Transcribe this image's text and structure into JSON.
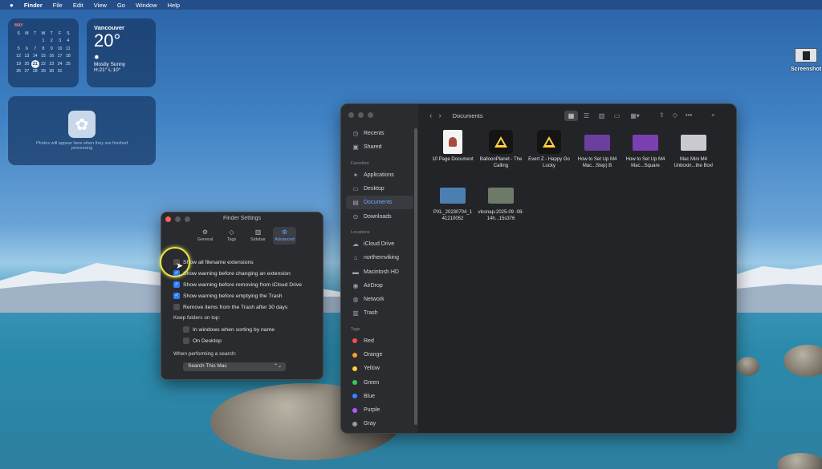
{
  "menubar": {
    "apple": "",
    "app": "Finder",
    "items": [
      "File",
      "Edit",
      "View",
      "Go",
      "Window",
      "Help"
    ]
  },
  "calendar": {
    "month": "MAY",
    "days": [
      "S",
      "M",
      "T",
      "W",
      "T",
      "F",
      "S"
    ],
    "weeks": [
      [
        "",
        "",
        "",
        "1",
        "2",
        "3",
        "4"
      ],
      [
        "5",
        "6",
        "7",
        "8",
        "9",
        "10",
        "11"
      ],
      [
        "12",
        "13",
        "14",
        "15",
        "16",
        "17",
        "18"
      ],
      [
        "19",
        "20",
        "21",
        "22",
        "23",
        "24",
        "25"
      ],
      [
        "26",
        "27",
        "28",
        "29",
        "30",
        "31",
        ""
      ]
    ],
    "today": "21"
  },
  "weather": {
    "city": "Vancouver",
    "temp": "20°",
    "condition": "Mostly Sunny",
    "highlow": "H:21° L:10°"
  },
  "photos_widget": {
    "text": "Photos will appear here when they are finished processing"
  },
  "desktop_icon": {
    "label": "Screenshot"
  },
  "finder": {
    "title": "Documents",
    "sidebar": {
      "top": [
        {
          "label": "Recents",
          "icon": "clock-icon",
          "glyph": "◷"
        },
        {
          "label": "Shared",
          "icon": "shared-folder-icon",
          "glyph": "▣"
        }
      ],
      "favorites_header": "Favorites",
      "favorites": [
        {
          "label": "Applications",
          "icon": "applications-icon",
          "glyph": "✦"
        },
        {
          "label": "Desktop",
          "icon": "desktop-icon",
          "glyph": "▭"
        },
        {
          "label": "Documents",
          "icon": "document-icon",
          "glyph": "▤"
        },
        {
          "label": "Downloads",
          "icon": "download-icon",
          "glyph": "⊙"
        }
      ],
      "locations_header": "Locations",
      "locations": [
        {
          "label": "iCloud Drive",
          "icon": "cloud-icon",
          "glyph": "☁"
        },
        {
          "label": "northernviking",
          "icon": "home-icon",
          "glyph": "⌂"
        },
        {
          "label": "Macintosh HD",
          "icon": "disk-icon",
          "glyph": "▬"
        },
        {
          "label": "AirDrop",
          "icon": "airdrop-icon",
          "glyph": "◉"
        },
        {
          "label": "Network",
          "icon": "network-icon",
          "glyph": "◍"
        },
        {
          "label": "Trash",
          "icon": "trash-icon",
          "glyph": "▥"
        }
      ],
      "tags_header": "Tags",
      "tags": [
        {
          "label": "Red",
          "color": "#ff4b4b"
        },
        {
          "label": "Orange",
          "color": "#ff9a2e"
        },
        {
          "label": "Yellow",
          "color": "#ffd23a"
        },
        {
          "label": "Green",
          "color": "#3cc85a"
        },
        {
          "label": "Blue",
          "color": "#3a86ff"
        },
        {
          "label": "Purple",
          "color": "#b05cff"
        },
        {
          "label": "Gray",
          "color": "#9a9aa0"
        }
      ]
    },
    "files": [
      {
        "name": "10 Page Document",
        "kind": "doc"
      },
      {
        "name": "BalloonPlanet - The Calling",
        "kind": "tri"
      },
      {
        "name": "Evert Z - Happy Go Lucky",
        "kind": "tri"
      },
      {
        "name": "How to Set Up M4 Mac...Step) B",
        "kind": "vid",
        "color": "#6a3fa0"
      },
      {
        "name": "How to Set Up M4 Mac...Square",
        "kind": "vid",
        "color": "#7a3fb0"
      },
      {
        "name": "Mac Mini M4 Unboxin...the Box!",
        "kind": "vid",
        "color": "#c9c9cf"
      },
      {
        "name": "PXL_20230704_1 41210052",
        "kind": "vid",
        "color": "#4b7fb0"
      },
      {
        "name": "vlcsnap-2025-09 -08-14h...15s376",
        "kind": "vid",
        "color": "#6d7a6a"
      }
    ]
  },
  "settings": {
    "title": "Finder Settings",
    "tabs": [
      {
        "label": "General",
        "glyph": "⚙"
      },
      {
        "label": "Tags",
        "glyph": "◇"
      },
      {
        "label": "Sidebar",
        "glyph": "▥"
      },
      {
        "label": "Advanced",
        "glyph": "⚙"
      }
    ],
    "options": [
      {
        "label": "Show all filename extensions",
        "checked": false
      },
      {
        "label": "Show warning before changing an extension",
        "checked": true
      },
      {
        "label": "Show warning before removing from iCloud Drive",
        "checked": true
      },
      {
        "label": "Show warning before emptying the Trash",
        "checked": true
      },
      {
        "label": "Remove items from the Trash after 30 days",
        "checked": false
      }
    ],
    "keep_folders_label": "Keep folders on top:",
    "keep_options": [
      {
        "label": "In windows when sorting by name",
        "checked": false
      },
      {
        "label": "On Desktop",
        "checked": false
      }
    ],
    "search_label": "When performing a search:",
    "search_value": "Search This Mac"
  }
}
